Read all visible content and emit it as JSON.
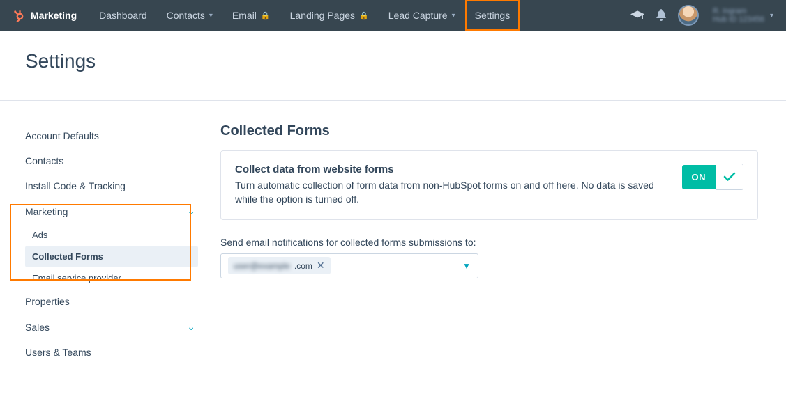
{
  "topnav": {
    "app_label": "Marketing",
    "items": [
      {
        "label": "Dashboard",
        "dropdown": false,
        "locked": false
      },
      {
        "label": "Contacts",
        "dropdown": true,
        "locked": false
      },
      {
        "label": "Email",
        "dropdown": false,
        "locked": true
      },
      {
        "label": "Landing Pages",
        "dropdown": false,
        "locked": true
      },
      {
        "label": "Lead Capture",
        "dropdown": true,
        "locked": false
      },
      {
        "label": "Settings",
        "dropdown": false,
        "locked": false,
        "highlighted": true
      }
    ],
    "account": {
      "line1": "R. Ingram",
      "line2": "Hub ID 123456"
    }
  },
  "page": {
    "title": "Settings"
  },
  "sidebar": {
    "items": [
      {
        "label": "Account Defaults"
      },
      {
        "label": "Contacts"
      },
      {
        "label": "Install Code & Tracking"
      },
      {
        "label": "Marketing",
        "expandable": true,
        "expanded": true,
        "children": [
          {
            "label": "Ads"
          },
          {
            "label": "Collected Forms",
            "active": true
          },
          {
            "label": "Email service provider"
          }
        ]
      },
      {
        "label": "Properties"
      },
      {
        "label": "Sales",
        "expandable": true
      },
      {
        "label": "Users & Teams"
      }
    ]
  },
  "main": {
    "section_title": "Collected Forms",
    "card": {
      "title": "Collect data from website forms",
      "desc": "Turn automatic collection of form data from non-HubSpot forms on and off here. No data is saved while the option is turned off.",
      "toggle_state": "ON"
    },
    "email_field": {
      "label": "Send email notifications for collected forms submissions to:",
      "chip_hidden": "user@example",
      "chip_suffix": ".com"
    }
  }
}
